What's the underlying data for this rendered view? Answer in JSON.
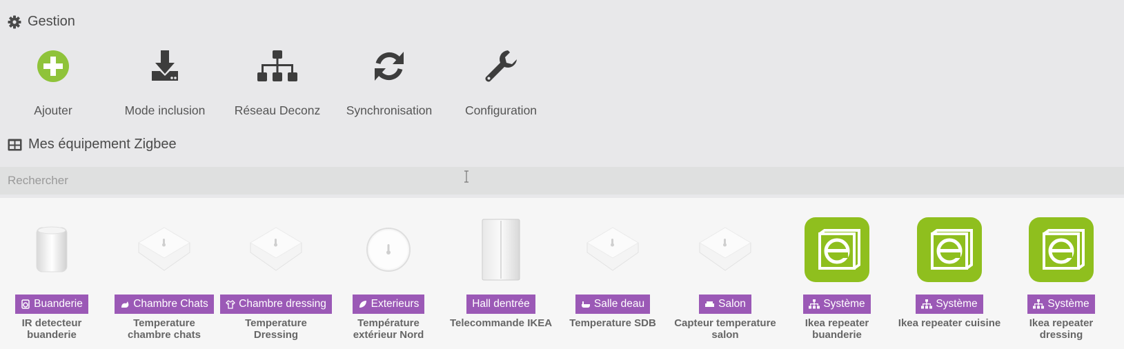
{
  "gestion": {
    "title": "Gestion",
    "actions": [
      {
        "label": "Ajouter",
        "icon": "plus-circle-icon",
        "color": "#8fc33a"
      },
      {
        "label": "Mode inclusion",
        "icon": "download-icon"
      },
      {
        "label": "Réseau Deconz",
        "icon": "sitemap-icon"
      },
      {
        "label": "Synchronisation",
        "icon": "refresh-icon"
      },
      {
        "label": "Configuration",
        "icon": "wrench-icon"
      }
    ]
  },
  "devices": {
    "title": "Mes équipement Zigbee",
    "search_placeholder": "Rechercher",
    "badge_color": "#9b59b6",
    "items": [
      {
        "room": "Buanderie",
        "name": "IR detecteur buanderie",
        "image": "motion-sensor",
        "room_icon": "washer-icon"
      },
      {
        "room": "Chambre Chats",
        "name": "Temperature chambre chats",
        "image": "temp-sensor-square",
        "room_icon": "cat-icon"
      },
      {
        "room": "Chambre dressing",
        "name": "Temperature Dressing",
        "image": "temp-sensor-square",
        "room_icon": "shirt-icon"
      },
      {
        "room": "Exterieurs",
        "name": "Température extérieur Nord",
        "image": "temp-sensor-round",
        "room_icon": "leaf-icon"
      },
      {
        "room": "Hall dentrée",
        "name": "Telecommande IKEA",
        "image": "wall-switch",
        "room_icon": ""
      },
      {
        "room": "Salle deau",
        "name": "Temperature SDB",
        "image": "temp-sensor-square",
        "room_icon": "bath-icon"
      },
      {
        "room": "Salon",
        "name": "Capteur temperature salon",
        "image": "temp-sensor-square",
        "room_icon": "sofa-icon"
      },
      {
        "room": "Système",
        "name": "Ikea repeater buanderie",
        "image": "deconz-logo",
        "room_icon": "sitemap-icon"
      },
      {
        "room": "Système",
        "name": "Ikea repeater cuisine",
        "image": "deconz-logo",
        "room_icon": "sitemap-icon"
      },
      {
        "room": "Système",
        "name": "Ikea repeater dressing",
        "image": "deconz-logo",
        "room_icon": "sitemap-icon"
      }
    ]
  }
}
